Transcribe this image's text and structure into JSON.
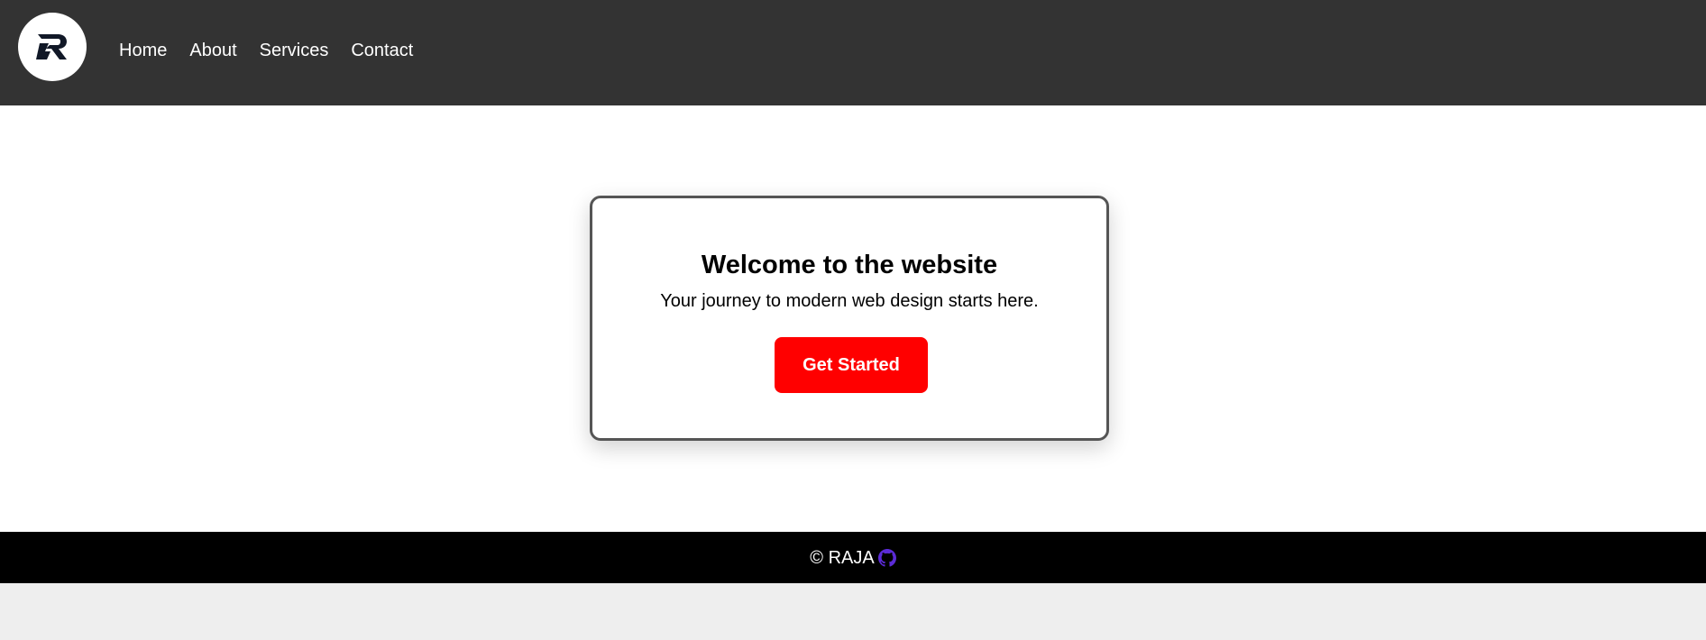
{
  "header": {
    "logo_icon": "r-logo-icon",
    "nav": [
      {
        "label": "Home"
      },
      {
        "label": "About"
      },
      {
        "label": "Services"
      },
      {
        "label": "Contact"
      }
    ]
  },
  "hero": {
    "title": "Welcome to the website",
    "subtitle": "Your journey to modern web design starts here.",
    "cta_label": "Get Started"
  },
  "footer": {
    "text": "© RAJA",
    "icon": "github-icon"
  },
  "colors": {
    "nav_bg": "#333333",
    "cta": "#ff0000",
    "footer_bg": "#000000",
    "github_icon": "#5b2bd6"
  }
}
